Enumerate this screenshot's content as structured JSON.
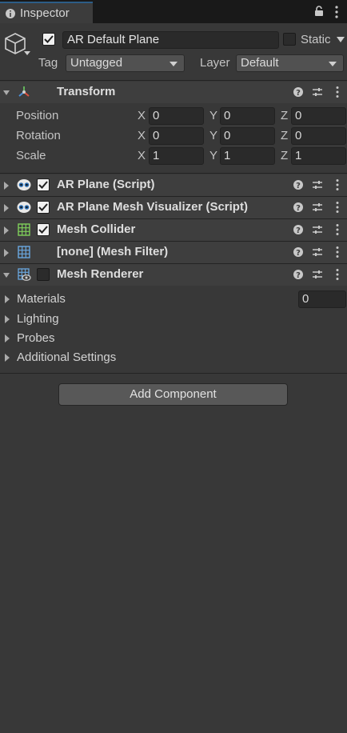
{
  "tab": {
    "label": "Inspector"
  },
  "header": {
    "object_name": "AR Default Plane",
    "active": true,
    "static_label": "Static",
    "tag_label": "Tag",
    "tag_value": "Untagged",
    "layer_label": "Layer",
    "layer_value": "Default"
  },
  "transform": {
    "title": "Transform",
    "rows": [
      {
        "label": "Position",
        "x": "0",
        "y": "0",
        "z": "0"
      },
      {
        "label": "Rotation",
        "x": "0",
        "y": "0",
        "z": "0"
      },
      {
        "label": "Scale",
        "x": "1",
        "y": "1",
        "z": "1"
      }
    ],
    "axes": [
      "X",
      "Y",
      "Z"
    ]
  },
  "components": [
    {
      "title": "AR Plane (Script)",
      "enabled": true
    },
    {
      "title": "AR Plane Mesh Visualizer (Script)",
      "enabled": true
    },
    {
      "title": "Mesh Collider",
      "enabled": true
    },
    {
      "title": "[none] (Mesh Filter)"
    },
    {
      "title": "Mesh Renderer",
      "enabled": false
    }
  ],
  "mesh_renderer": {
    "materials_label": "Materials",
    "materials_count": "0",
    "lighting_label": "Lighting",
    "probes_label": "Probes",
    "additional_label": "Additional Settings"
  },
  "add_component_label": "Add Component",
  "colors": {
    "background": "#383838",
    "tab_accent": "#2c5d87",
    "component_header": "#3e3e3e"
  }
}
